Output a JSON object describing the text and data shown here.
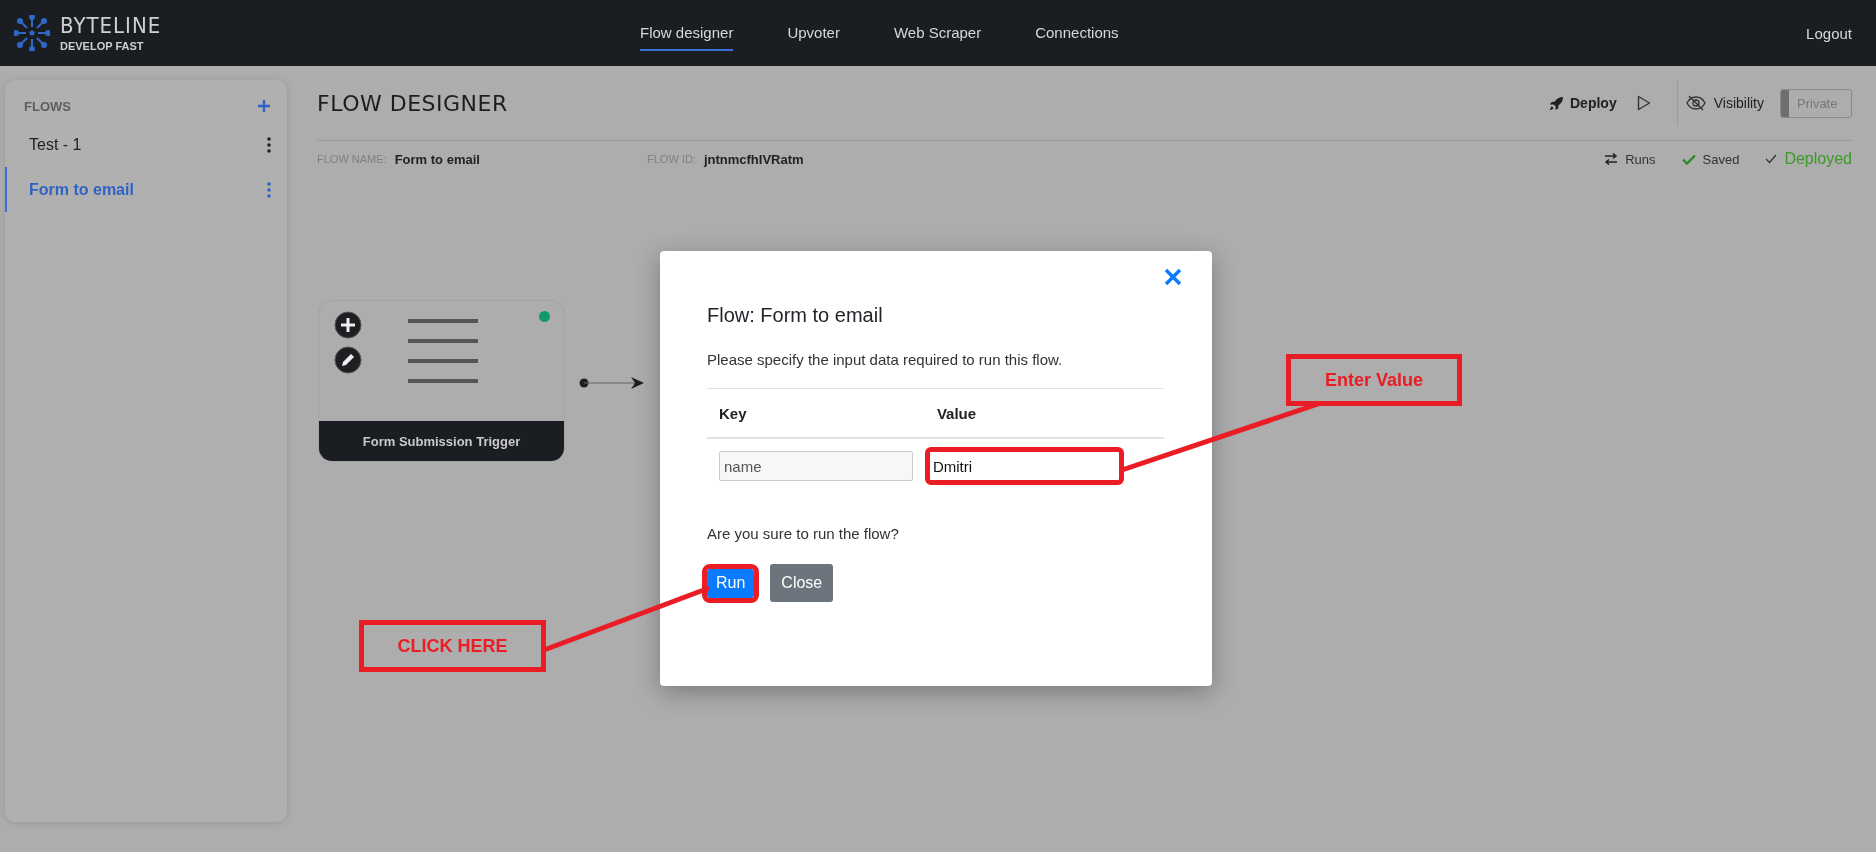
{
  "header": {
    "logo": {
      "name": "BYTELINE",
      "tagline": "DEVELOP FAST"
    },
    "nav": [
      {
        "label": "Flow designer",
        "selected": true
      },
      {
        "label": "Upvoter",
        "selected": false
      },
      {
        "label": "Web Scraper",
        "selected": false
      },
      {
        "label": "Connections",
        "selected": false
      }
    ],
    "logout": "Logout"
  },
  "sidebar": {
    "title": "FLOWS",
    "items": [
      {
        "label": "Test - 1",
        "selected": false
      },
      {
        "label": "Form to email",
        "selected": true
      }
    ]
  },
  "designer": {
    "title": "FLOW DESIGNER",
    "deploy": "Deploy",
    "visibility": {
      "label": "Visibility",
      "value": "Private",
      "on": false
    },
    "flow_name": {
      "label": "FLOW NAME:",
      "value": "Form to email"
    },
    "flow_id": {
      "label": "FLOW ID:",
      "value": "jntnmcfhIVRatm"
    },
    "status": [
      {
        "kind": "runs",
        "label": "Runs"
      },
      {
        "kind": "saved",
        "label": "Saved"
      },
      {
        "kind": "deployed",
        "label": "Deployed"
      }
    ]
  },
  "canvas": {
    "nodes": [
      {
        "label": "Form Submission Trigger",
        "active": true
      }
    ]
  },
  "dialog": {
    "title": "Flow: Form to email",
    "description": "Please specify the input data required to run this flow.",
    "columns": [
      "Key",
      "Value"
    ],
    "rows": [
      {
        "key": "name",
        "value": "Dmitri"
      }
    ],
    "question": "Are you sure to run the flow?",
    "buttons": [
      {
        "label": "Run",
        "kind": "primary"
      },
      {
        "label": "Close",
        "kind": "secondary"
      }
    ]
  },
  "annotations": [
    {
      "kind": "value",
      "label": "Enter Value"
    },
    {
      "kind": "run",
      "label": "CLICK HERE"
    }
  ]
}
